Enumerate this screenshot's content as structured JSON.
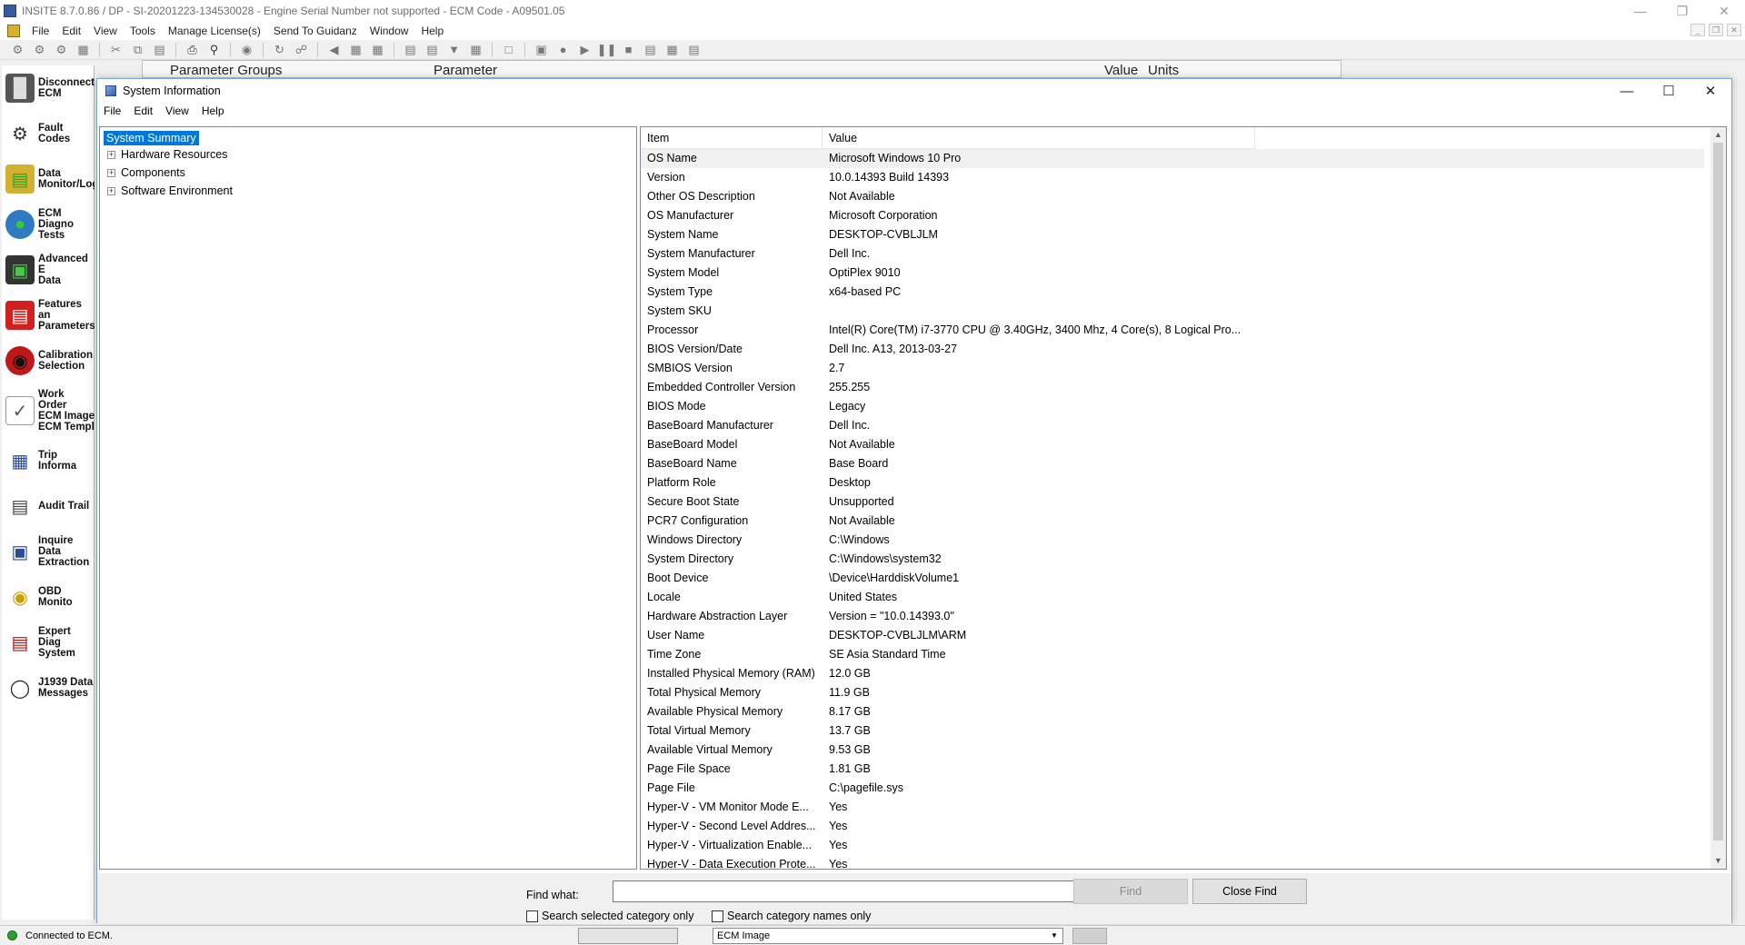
{
  "app": {
    "title": "INSITE 8.7.0.86  / DP - SI-20201223-134530028 - Engine Serial Number not supported - ECM Code - A09501.05",
    "menu": [
      "File",
      "Edit",
      "View",
      "Tools",
      "Manage License(s)",
      "Send To Guidanz",
      "Window",
      "Help"
    ]
  },
  "left_nav": [
    {
      "label": "Disconnect\nECM",
      "icon": "disconnect-icon"
    },
    {
      "label": "Fault Codes",
      "icon": "fault-codes-icon"
    },
    {
      "label": "Data\nMonitor/Log",
      "icon": "data-monitor-icon"
    },
    {
      "label": "ECM Diagno\nTests",
      "icon": "ecm-diagnostic-icon"
    },
    {
      "label": "Advanced E\nData",
      "icon": "advanced-data-icon"
    },
    {
      "label": "Features an\nParameters",
      "icon": "features-parameters-icon"
    },
    {
      "label": "Calibration\nSelection",
      "icon": "calibration-icon"
    },
    {
      "label": "Work Order\nECM Image\nECM Templ",
      "icon": "work-order-icon"
    },
    {
      "label": "Trip Informa",
      "icon": "trip-info-icon"
    },
    {
      "label": "Audit Trail",
      "icon": "audit-trail-icon"
    },
    {
      "label": "Inquire Data\nExtraction",
      "icon": "inquire-data-icon"
    },
    {
      "label": "OBD Monito",
      "icon": "obd-monitor-icon"
    },
    {
      "label": "Expert Diag\nSystem",
      "icon": "expert-diag-icon"
    },
    {
      "label": "J1939 Data\nMessages",
      "icon": "j1939-icon"
    }
  ],
  "param_header": {
    "groups": "Parameter Groups",
    "parameter": "Parameter",
    "value": "Value",
    "units": "Units"
  },
  "sysinfo": {
    "title": "System Information",
    "menu": [
      "File",
      "Edit",
      "View",
      "Help"
    ],
    "tree": [
      {
        "label": "System Summary",
        "selected": true,
        "expandable": false
      },
      {
        "label": "Hardware Resources",
        "expandable": true
      },
      {
        "label": "Components",
        "expandable": true
      },
      {
        "label": "Software Environment",
        "expandable": true
      }
    ],
    "columns": [
      "Item",
      "Value"
    ],
    "rows": [
      [
        "OS Name",
        "Microsoft Windows 10 Pro"
      ],
      [
        "Version",
        "10.0.14393 Build 14393"
      ],
      [
        "Other OS Description",
        "Not Available"
      ],
      [
        "OS Manufacturer",
        "Microsoft Corporation"
      ],
      [
        "System Name",
        "DESKTOP-CVBLJLM"
      ],
      [
        "System Manufacturer",
        "Dell Inc."
      ],
      [
        "System Model",
        "OptiPlex 9010"
      ],
      [
        "System Type",
        "x64-based PC"
      ],
      [
        "System SKU",
        ""
      ],
      [
        "Processor",
        "Intel(R) Core(TM) i7-3770 CPU @ 3.40GHz, 3400 Mhz, 4 Core(s), 8 Logical Pro..."
      ],
      [
        "BIOS Version/Date",
        "Dell Inc. A13, 2013-03-27"
      ],
      [
        "SMBIOS Version",
        "2.7"
      ],
      [
        "Embedded Controller Version",
        "255.255"
      ],
      [
        "BIOS Mode",
        "Legacy"
      ],
      [
        "BaseBoard Manufacturer",
        "Dell Inc."
      ],
      [
        "BaseBoard Model",
        "Not Available"
      ],
      [
        "BaseBoard Name",
        "Base Board"
      ],
      [
        "Platform Role",
        "Desktop"
      ],
      [
        "Secure Boot State",
        "Unsupported"
      ],
      [
        "PCR7 Configuration",
        "Not Available"
      ],
      [
        "Windows Directory",
        "C:\\Windows"
      ],
      [
        "System Directory",
        "C:\\Windows\\system32"
      ],
      [
        "Boot Device",
        "\\Device\\HarddiskVolume1"
      ],
      [
        "Locale",
        "United States"
      ],
      [
        "Hardware Abstraction Layer",
        "Version = \"10.0.14393.0\""
      ],
      [
        "User Name",
        "DESKTOP-CVBLJLM\\ARM"
      ],
      [
        "Time Zone",
        "SE Asia Standard Time"
      ],
      [
        "Installed Physical Memory (RAM)",
        "12.0 GB"
      ],
      [
        "Total Physical Memory",
        "11.9 GB"
      ],
      [
        "Available Physical Memory",
        "8.17 GB"
      ],
      [
        "Total Virtual Memory",
        "13.7 GB"
      ],
      [
        "Available Virtual Memory",
        "9.53 GB"
      ],
      [
        "Page File Space",
        "1.81 GB"
      ],
      [
        "Page File",
        "C:\\pagefile.sys"
      ],
      [
        "Hyper-V - VM Monitor Mode E...",
        "Yes"
      ],
      [
        "Hyper-V - Second Level Addres...",
        "Yes"
      ],
      [
        "Hyper-V - Virtualization Enable...",
        "Yes"
      ],
      [
        "Hyper-V - Data Execution Prote...",
        "Yes"
      ]
    ],
    "find": {
      "label": "Find what:",
      "value": "",
      "find_button": "Find",
      "close_button": "Close Find",
      "opt1": "Search selected category only",
      "opt2": "Search category names only"
    }
  },
  "status": {
    "text": "Connected to ECM.",
    "combo": "ECM Image"
  }
}
